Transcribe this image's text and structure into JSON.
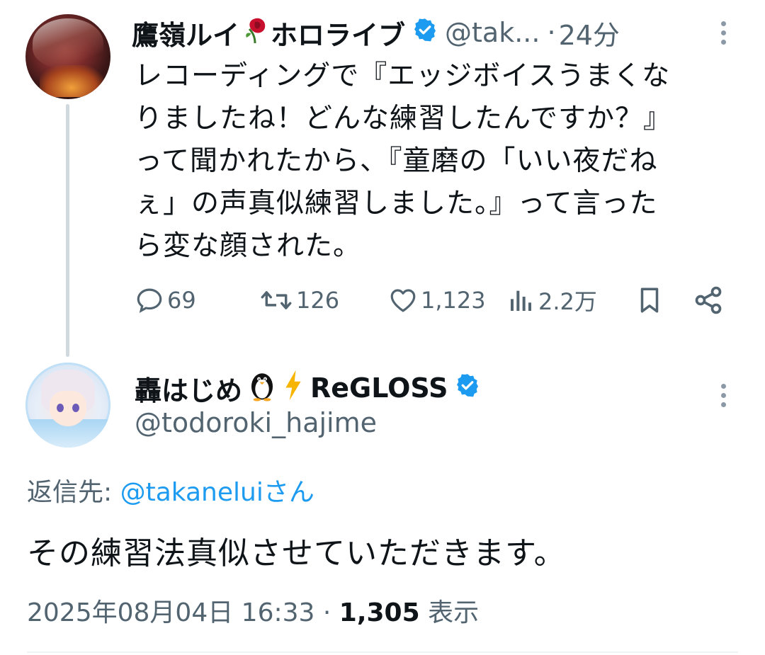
{
  "tweet1": {
    "display_name": "鷹嶺ルイ",
    "display_name_suffix": "ホロライブ",
    "handle": "@tak...",
    "separator": "·",
    "time": "24分",
    "text_lines": [
      "レコーディングで『エッジボイスうまくな",
      "りましたね！どんな練習したんですか？』",
      "って聞かれたから、『童磨の「いい夜だね",
      "ぇ」の声真似練習しました。』って言った",
      "ら変な顔された。"
    ],
    "actions": {
      "replies": "69",
      "retweets": "126",
      "likes": "1,123",
      "views": "2.2万"
    }
  },
  "tweet2": {
    "display_name": "轟はじめ",
    "display_name_suffix": "ReGLOSS",
    "handle": "@todoroki_hajime",
    "reply_label": "返信先: ",
    "reply_mention": "@takaneluiさん",
    "text": "その練習法真似させていただきます。",
    "date": "2025年08月04日 16:33 · ",
    "views_count": "1,305",
    "views_label": " 表示"
  },
  "icons": {
    "badge": "verified-badge-icon",
    "rose": "wilted-rose-icon",
    "penguin": "penguin-icon",
    "lightning": "lightning-icon",
    "reply": "reply-icon",
    "retweet": "retweet-icon",
    "like": "heart-icon",
    "views": "views-icon",
    "bookmark": "bookmark-icon",
    "share": "share-icon",
    "more": "more-options-icon"
  },
  "colors": {
    "text": "#0f1419",
    "secondary": "#536471",
    "accent": "#1d9bf0",
    "thread_line": "#cfd9de"
  }
}
